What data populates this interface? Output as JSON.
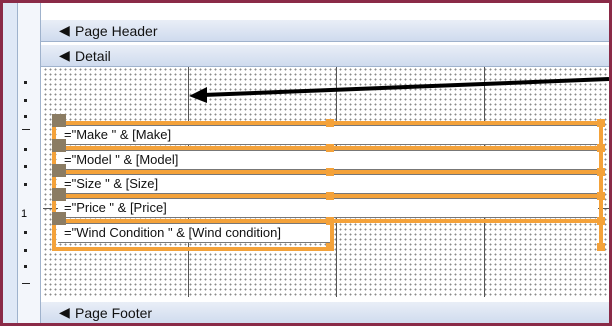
{
  "sections": {
    "page_header": {
      "icon": "collapse-arrow-icon",
      "label": "Page Header"
    },
    "detail": {
      "icon": "collapse-arrow-icon",
      "label": "Detail"
    },
    "page_footer": {
      "icon": "collapse-arrow-icon",
      "label": "Page Footer"
    }
  },
  "ruler": {
    "mark_label": "1"
  },
  "controls": [
    {
      "expression": "=\"Make \" & [Make]"
    },
    {
      "expression": "=\"Model \" & [Model]"
    },
    {
      "expression": "=\"Size \" & [Size]"
    },
    {
      "expression": "=\"Price \" & [Price]"
    },
    {
      "expression": "=\"Wind Condition \" & [Wind condition]"
    }
  ],
  "colors": {
    "selection": "#f4a23a",
    "frame_border": "#8a2a47",
    "band": "#cfdbee"
  }
}
